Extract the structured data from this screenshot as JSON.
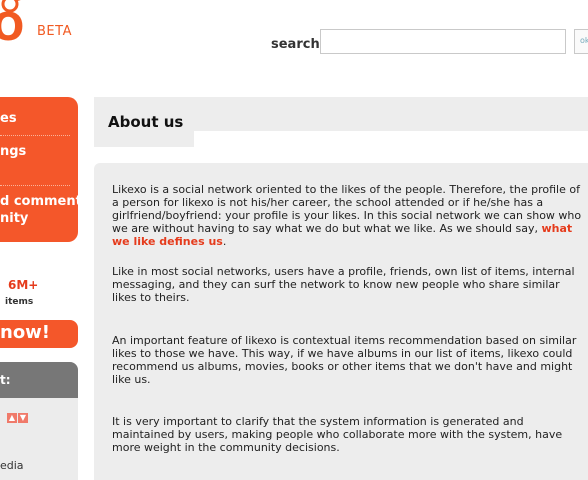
{
  "brand": {
    "logo_text": "O",
    "beta": "BETA",
    "accent": "#f15a22"
  },
  "search": {
    "label": "search",
    "value": "",
    "placeholder": "",
    "button_label": "ok"
  },
  "side_menu": {
    "items": [
      "es",
      "ngs",
      "d comment",
      "nity"
    ]
  },
  "stats": {
    "count": "6M+",
    "count_label": "items",
    "cta": "now!"
  },
  "side_box": {
    "title": "t:",
    "up_icon": "arrow-up-icon",
    "down_icon": "arrow-down-icon",
    "item": "edia"
  },
  "about": {
    "title": "About us",
    "paragraphs": {
      "p1_before": "Likexo is a social network oriented to the likes of the people. Therefore, the profile of a person for likexo is not his/her career, the school attended or if he/she has a girlfriend/boyfriend: your profile is your likes. In this social network we can show who we are without having to say what we do but what we like. As we should say, ",
      "p1_highlight": "what we like defines us",
      "p1_after": ".",
      "p2": "Like in most social networks, users have a profile, friends, own list of items, internal messaging, and they can surf the network to know new people who share similar likes to theirs.",
      "p3": "An important feature of likexo is contextual items recommendation based on similar likes to those we have. This way, if we have albums in our list of items, likexo could recommend us albums, movies, books or other items that we don't have and might like us.",
      "p4": "It is very important to clarify that the system information is generated and maintained by users, making people who collaborate more with the system, have more weight in the community decisions."
    }
  }
}
